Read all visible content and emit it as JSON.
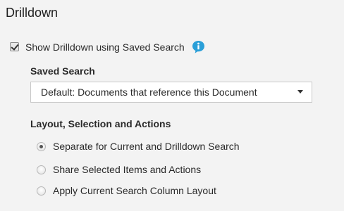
{
  "section": {
    "title": "Drilldown"
  },
  "show_drilldown": {
    "label": "Show Drilldown using Saved Search",
    "checked": true,
    "info_icon": "info-icon",
    "info_color": "#2a9fd8"
  },
  "saved_search": {
    "label": "Saved Search",
    "selected": "Default: Documents that reference this Document"
  },
  "layout": {
    "label": "Layout, Selection and Actions",
    "options": [
      {
        "label": "Separate for Current and Drilldown Search",
        "checked": true
      },
      {
        "label": "Share Selected Items and Actions",
        "checked": false
      },
      {
        "label": "Apply Current Search Column Layout",
        "checked": false
      }
    ]
  }
}
